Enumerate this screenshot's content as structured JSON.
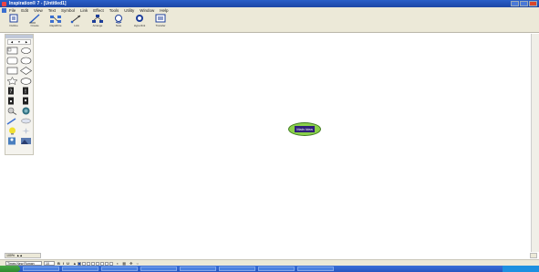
{
  "window": {
    "title": "Inspiration® 7 - [Untitled1]"
  },
  "menu": {
    "items": [
      "File",
      "Edit",
      "View",
      "Text",
      "Symbol",
      "Link",
      "Effect",
      "Tools",
      "Utility",
      "Window",
      "Help"
    ]
  },
  "toolbar": {
    "tools": [
      {
        "label": "Outline",
        "icon": "outline-view-icon"
      },
      {
        "label": "Create",
        "icon": "pencil-icon"
      },
      {
        "label": "RapidFire",
        "icon": "rapidfire-icon"
      },
      {
        "label": "Link",
        "icon": "link-icon"
      },
      {
        "label": "Arrange",
        "icon": "arrange-icon"
      },
      {
        "label": "Note",
        "icon": "note-icon"
      },
      {
        "label": "Hyperlink",
        "icon": "hyperlink-icon"
      },
      {
        "label": "Transfer",
        "icon": "transfer-icon"
      }
    ]
  },
  "canvas": {
    "main_idea_label": "Main Idea"
  },
  "format_bar": {
    "font": "Times New Roman",
    "size": "10",
    "bold": "B",
    "italic": "I",
    "underline": "U"
  },
  "zoom": {
    "label": "100%"
  },
  "colors": {
    "title_bar": "#1c46a6",
    "chrome": "#ece9d8",
    "main_idea_fill": "#8ad04a",
    "main_idea_label_bg": "#2e1f7a"
  }
}
